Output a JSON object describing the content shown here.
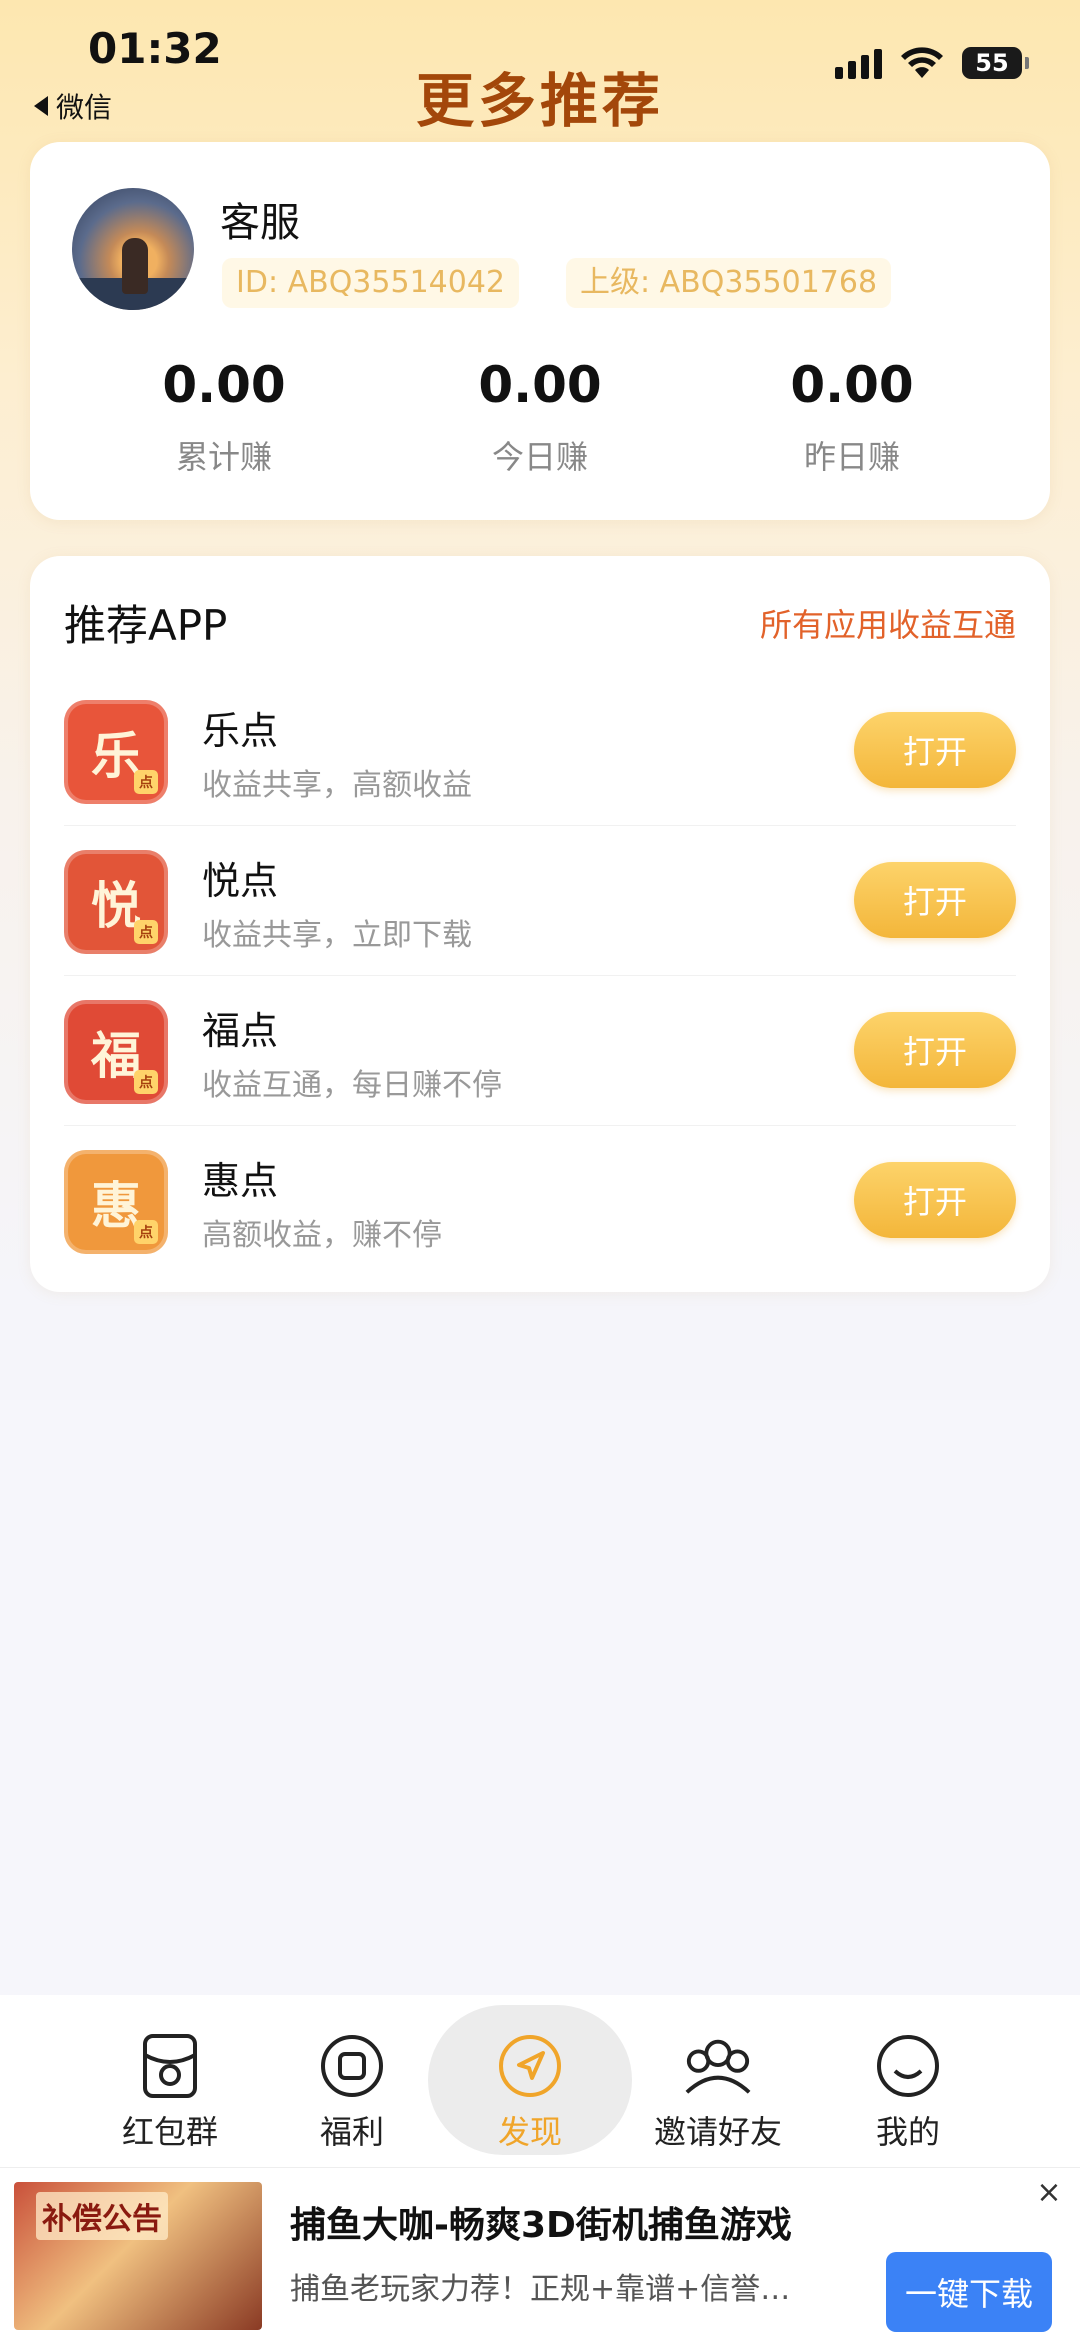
{
  "status_bar": {
    "time": "01:32",
    "back_label": "微信",
    "battery": "55"
  },
  "header": {
    "title": "更多推荐"
  },
  "profile": {
    "name": "客服",
    "id_label": "ID: ABQ35514042",
    "parent_label": "上级: ABQ35501768",
    "stats": [
      {
        "value": "0.00",
        "label": "累计赚"
      },
      {
        "value": "0.00",
        "label": "今日赚"
      },
      {
        "value": "0.00",
        "label": "昨日赚"
      }
    ]
  },
  "recommend": {
    "title": "推荐APP",
    "link": "所有应用收益互通",
    "apps": [
      {
        "icon_char": "乐",
        "name": "乐点",
        "desc": "收益共享，高额收益",
        "button": "打开",
        "color": "#e8553a"
      },
      {
        "icon_char": "悦",
        "name": "悦点",
        "desc": "收益共享，立即下载",
        "button": "打开",
        "color": "#e25538"
      },
      {
        "icon_char": "福",
        "name": "福点",
        "desc": "收益互通，每日赚不停",
        "button": "打开",
        "color": "#e04a36"
      },
      {
        "icon_char": "惠",
        "name": "惠点",
        "desc": "高额收益，赚不停",
        "button": "打开",
        "color": "#f0983c"
      }
    ],
    "mini_badge": "点"
  },
  "bottom_nav": {
    "items": [
      {
        "label": "红包群",
        "icon": "red-envelope-icon"
      },
      {
        "label": "福利",
        "icon": "square-icon"
      },
      {
        "label": "发现",
        "icon": "compass-icon",
        "active": true
      },
      {
        "label": "邀请好友",
        "icon": "group-icon"
      },
      {
        "label": "我的",
        "icon": "smile-icon"
      }
    ]
  },
  "ad": {
    "thumb_label": "补偿公告",
    "title": "捕鱼大咖-畅爽3D街机捕鱼游戏",
    "subtitle": "捕鱼老玩家力荐！正规+靠谱+信誉…",
    "button": "一键下载",
    "close": "×"
  },
  "colors": {
    "accent": "#f0a52a",
    "title": "#a3470a",
    "link": "#e2622a",
    "ad_button": "#3b82f6"
  }
}
